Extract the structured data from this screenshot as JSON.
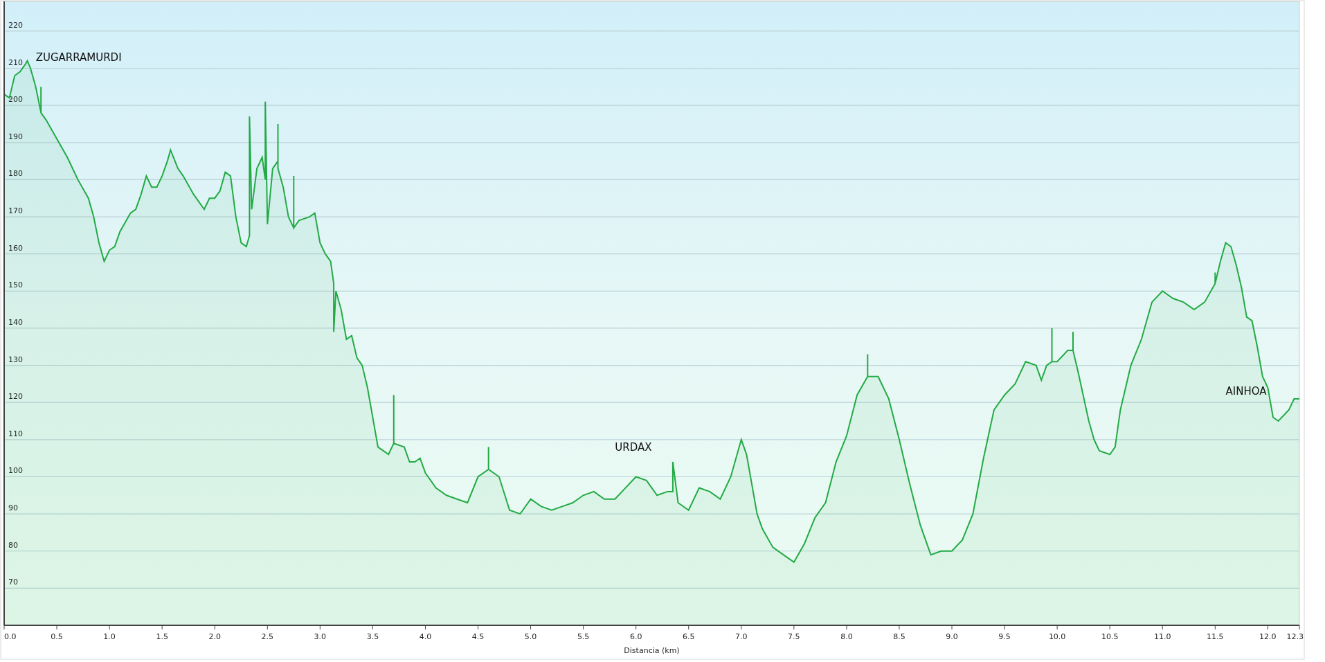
{
  "elevation_profile": {
    "chart_data": {
      "type": "area",
      "xlabel": "Distancia (km)",
      "xlim": [
        0,
        12.3
      ],
      "ylim": [
        60,
        228
      ],
      "xticks": [
        {
          "value": 0,
          "label": "0.0"
        },
        {
          "value": 0.5,
          "label": "0.5"
        },
        {
          "value": 1,
          "label": "1.0"
        },
        {
          "value": 1.5,
          "label": "1.5"
        },
        {
          "value": 2,
          "label": "2.0"
        },
        {
          "value": 2.5,
          "label": "2.5"
        },
        {
          "value": 3,
          "label": "3.0"
        },
        {
          "value": 3.5,
          "label": "3.5"
        },
        {
          "value": 4,
          "label": "4.0"
        },
        {
          "value": 4.5,
          "label": "4.5"
        },
        {
          "value": 5,
          "label": "5.0"
        },
        {
          "value": 5.5,
          "label": "5.5"
        },
        {
          "value": 6,
          "label": "6.0"
        },
        {
          "value": 6.5,
          "label": "6.5"
        },
        {
          "value": 7,
          "label": "7.0"
        },
        {
          "value": 7.5,
          "label": "7.5"
        },
        {
          "value": 8,
          "label": "8.0"
        },
        {
          "value": 8.5,
          "label": "8.5"
        },
        {
          "value": 9,
          "label": "9.0"
        },
        {
          "value": 9.5,
          "label": "9.5"
        },
        {
          "value": 10,
          "label": "10.0"
        },
        {
          "value": 10.5,
          "label": "10.5"
        },
        {
          "value": 11,
          "label": "11.0"
        },
        {
          "value": 11.5,
          "label": "11.5"
        },
        {
          "value": 12,
          "label": "12.0"
        },
        {
          "value": 12.3,
          "label": "12.3"
        }
      ],
      "yticks": [
        70,
        80,
        90,
        100,
        110,
        120,
        130,
        140,
        150,
        160,
        170,
        180,
        190,
        200,
        210,
        220
      ],
      "x": [
        0,
        0.05,
        0.1,
        0.15,
        0.2,
        0.22,
        0.25,
        0.3,
        0.35,
        0.35,
        0.35,
        0.4,
        0.5,
        0.6,
        0.7,
        0.8,
        0.85,
        0.9,
        0.95,
        1.0,
        1.05,
        1.1,
        1.2,
        1.25,
        1.3,
        1.35,
        1.4,
        1.45,
        1.5,
        1.55,
        1.58,
        1.65,
        1.7,
        1.8,
        1.9,
        1.95,
        2.0,
        2.05,
        2.1,
        2.15,
        2.2,
        2.25,
        2.3,
        2.33,
        2.33,
        2.35,
        2.4,
        2.45,
        2.48,
        2.48,
        2.5,
        2.55,
        2.6,
        2.6,
        2.6,
        2.65,
        2.7,
        2.75,
        2.75,
        2.75,
        2.8,
        2.9,
        2.95,
        3.0,
        3.05,
        3.1,
        3.13,
        3.13,
        3.15,
        3.2,
        3.25,
        3.3,
        3.35,
        3.4,
        3.45,
        3.5,
        3.55,
        3.6,
        3.65,
        3.7,
        3.7,
        3.7,
        3.8,
        3.85,
        3.9,
        3.95,
        4.0,
        4.1,
        4.2,
        4.3,
        4.4,
        4.5,
        4.6,
        4.6,
        4.6,
        4.7,
        4.8,
        4.9,
        5.0,
        5.1,
        5.2,
        5.3,
        5.4,
        5.5,
        5.6,
        5.7,
        5.8,
        5.9,
        6.0,
        6.1,
        6.2,
        6.3,
        6.35,
        6.35,
        6.4,
        6.5,
        6.6,
        6.7,
        6.8,
        6.9,
        7.0,
        7.05,
        7.1,
        7.15,
        7.2,
        7.3,
        7.4,
        7.5,
        7.6,
        7.7,
        7.8,
        7.9,
        8.0,
        8.1,
        8.2,
        8.2,
        8.2,
        8.3,
        8.4,
        8.5,
        8.6,
        8.7,
        8.8,
        8.9,
        9.0,
        9.1,
        9.2,
        9.3,
        9.4,
        9.5,
        9.6,
        9.7,
        9.8,
        9.85,
        9.9,
        9.95,
        9.95,
        9.95,
        10.0,
        10.1,
        10.15,
        10.15,
        10.15,
        10.2,
        10.3,
        10.35,
        10.4,
        10.5,
        10.55,
        10.6,
        10.7,
        10.8,
        10.9,
        11.0,
        11.1,
        11.2,
        11.3,
        11.4,
        11.5,
        11.5,
        11.5,
        11.55,
        11.6,
        11.65,
        11.7,
        11.75,
        11.8,
        11.85,
        11.9,
        11.95,
        12.0,
        12.05,
        12.1,
        12.2,
        12.25,
        12.3
      ],
      "series": [
        {
          "color": "#22aa44",
          "values": [
            203,
            202,
            208,
            209,
            211,
            212,
            210,
            205,
            198,
            205,
            198,
            196,
            191,
            186,
            180,
            175,
            170,
            163,
            158,
            161,
            162,
            166,
            171,
            172,
            176,
            181,
            178,
            178,
            181,
            185,
            188,
            183,
            181,
            176,
            172,
            175,
            175,
            177,
            182,
            181,
            170,
            163,
            162,
            165,
            197,
            172,
            183,
            186,
            180,
            201,
            168,
            183,
            185,
            195,
            183,
            178,
            170,
            167,
            181,
            167,
            169,
            170,
            171,
            163,
            160,
            158,
            152,
            139,
            150,
            145,
            137,
            138,
            132,
            130,
            124,
            116,
            108,
            107,
            106,
            109,
            122,
            109,
            108,
            104,
            104,
            105,
            101,
            97,
            95,
            94,
            93,
            100,
            102,
            108,
            102,
            100,
            91,
            90,
            94,
            92,
            91,
            92,
            93,
            95,
            96,
            94,
            94,
            97,
            100,
            99,
            95,
            96,
            96,
            104,
            93,
            91,
            97,
            96,
            94,
            100,
            110,
            106,
            98,
            90,
            86,
            81,
            79,
            77,
            82,
            89,
            93,
            104,
            111,
            122,
            127,
            133,
            127,
            127,
            121,
            110,
            98,
            87,
            79,
            80,
            80,
            83,
            90,
            105,
            118,
            122,
            125,
            131,
            130,
            126,
            130,
            131,
            140,
            131,
            131,
            134,
            134,
            139,
            134,
            128,
            115,
            110,
            107,
            106,
            108,
            118,
            130,
            137,
            147,
            150,
            148,
            147,
            145,
            147,
            152,
            155,
            152,
            158,
            163,
            162,
            157,
            151,
            143,
            142,
            135,
            127,
            124,
            116,
            115,
            118,
            121,
            121
          ]
        }
      ],
      "grid": true,
      "annotations": [
        "ZUGARRAMURDI",
        "URDAX",
        "AINHOA"
      ]
    }
  }
}
